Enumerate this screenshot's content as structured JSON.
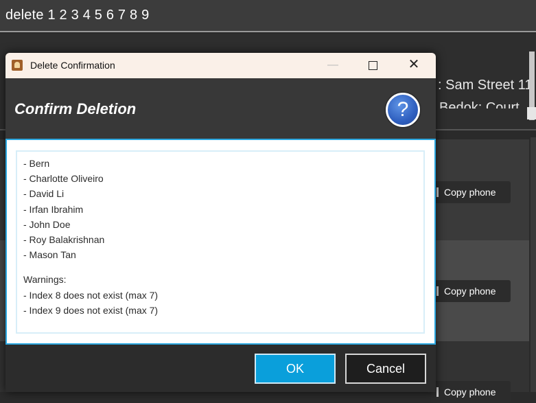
{
  "command_box": {
    "value": "delete 1 2 3 4 5 6 7 8 9"
  },
  "background": {
    "address_line1": ": Sam Street 11",
    "address_line2": "Bedok: Court",
    "copy_phone_label": "Copy phone"
  },
  "dialog": {
    "window_title": "Delete Confirmation",
    "header_title": "Confirm Deletion",
    "help_icon_glyph": "?",
    "names": [
      "- Bern",
      "- Charlotte Oliveiro",
      "- David Li",
      "- Irfan Ibrahim",
      "- John Doe",
      "- Roy Balakrishnan",
      "- Mason Tan"
    ],
    "warnings_heading": "Warnings:",
    "warnings": [
      "- Index 8 does not exist (max 7)",
      "- Index 9 does not exist (max 7)"
    ],
    "ok_label": "OK",
    "cancel_label": "Cancel",
    "titlebar_icons": {
      "min": "minimize-icon",
      "max": "maximize-icon",
      "close": "close-icon"
    }
  },
  "colors": {
    "accent": "#0a9fdb",
    "titlebar": "#faf0e8",
    "help_icon": "#2f5fbf"
  }
}
